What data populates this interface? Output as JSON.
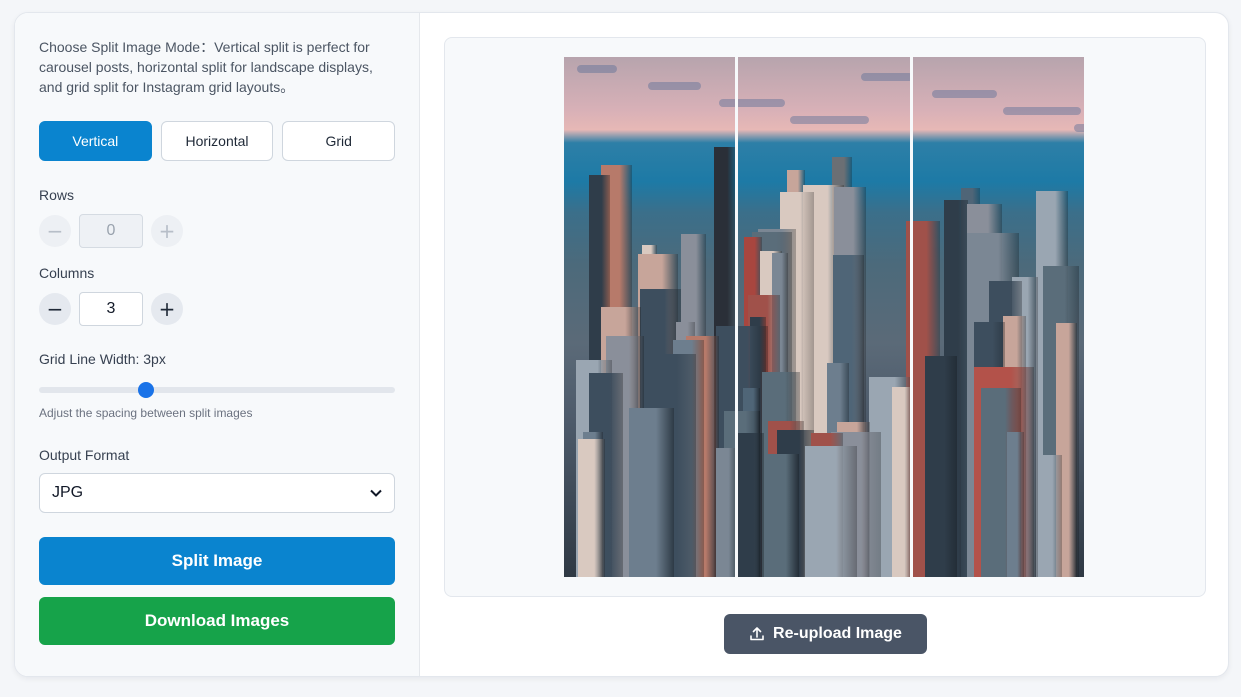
{
  "settings": {
    "description": "Choose Split Image Mode：Vertical split is perfect for carousel posts, horizontal split for landscape displays, and grid split for Instagram grid layouts。",
    "modes": [
      {
        "label": "Vertical",
        "active": true
      },
      {
        "label": "Horizontal",
        "active": false
      },
      {
        "label": "Grid",
        "active": false
      }
    ],
    "rows": {
      "label": "Rows",
      "value": "0",
      "enabled": false
    },
    "columns": {
      "label": "Columns",
      "value": "3",
      "enabled": true
    },
    "grid_line": {
      "label": "Grid Line Width: 3px",
      "value": 3,
      "min": 0,
      "max": 10,
      "hint": "Adjust the spacing between split images"
    },
    "output_format": {
      "label": "Output Format",
      "selected": "JPG"
    },
    "split_button": "Split Image",
    "download_button": "Download Images"
  },
  "preview": {
    "image_icon": "city-skyline-photo",
    "reupload_button": "Re-upload Image",
    "reupload_icon": "upload-icon"
  },
  "colors": {
    "accent": "#0a84cf",
    "download": "#16a34a",
    "reupload_bg": "#4a5566"
  }
}
